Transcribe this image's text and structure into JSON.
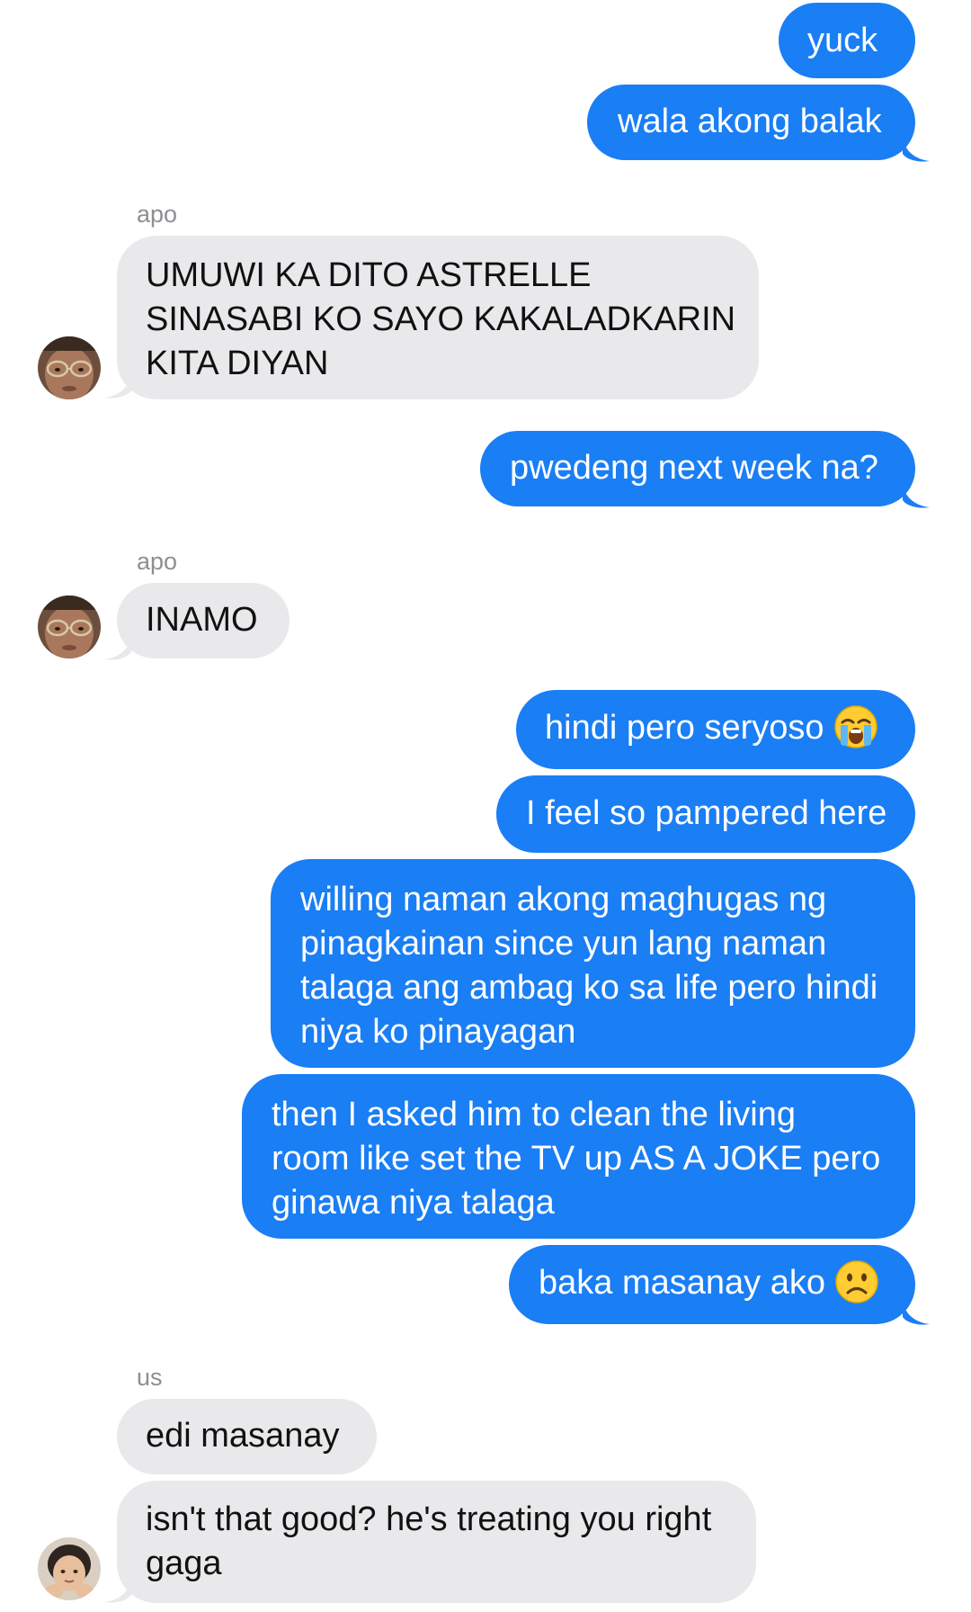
{
  "conversation": {
    "messages": [
      {
        "from": "me",
        "text": "yuck"
      },
      {
        "from": "me",
        "text": "wala akong balak"
      },
      {
        "from": "apo",
        "sender_label": "apo",
        "text_lines": [
          "UMUWI KA DITO ASTRELLE",
          "SINASABI KO SAYO KAKALADKARIN",
          "KITA DIYAN"
        ]
      },
      {
        "from": "me",
        "text": "pwedeng next week na?"
      },
      {
        "from": "apo",
        "sender_label": "apo",
        "text": "INAMO"
      },
      {
        "from": "me",
        "text": "hindi pero seryoso",
        "emoji": "loudly-crying-face"
      },
      {
        "from": "me",
        "text": "I feel so pampered here"
      },
      {
        "from": "me",
        "text_lines": [
          "willing naman akong maghugas ng",
          "pinagkainan since yun lang naman",
          "talaga ang ambag ko sa life pero hindi",
          "niya ko pinayagan"
        ]
      },
      {
        "from": "me",
        "text_lines": [
          "then I asked him to clean the living",
          "room like set the TV up AS A JOKE pero",
          "ginawa niya talaga"
        ]
      },
      {
        "from": "me",
        "text": "baka masanay ako",
        "emoji": "frowning-face"
      },
      {
        "from": "us",
        "sender_label": "us",
        "text": "edi masanay"
      },
      {
        "from": "us",
        "text_lines": [
          "isn't that good? he's treating you right",
          "gaga"
        ]
      }
    ]
  },
  "colors": {
    "outgoing_bubble": "#1a7ef5",
    "incoming_bubble": "#e9e9eb",
    "sender_label": "#8e8e93"
  }
}
